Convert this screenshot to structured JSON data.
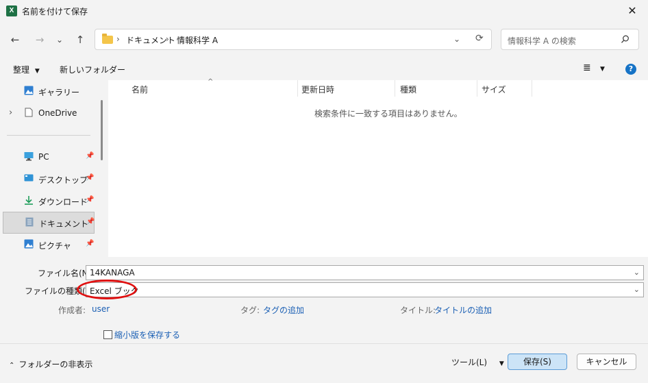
{
  "window": {
    "title": "名前を付けて保存",
    "app_icon_letter": "X",
    "close_glyph": "✕"
  },
  "nav": {
    "back": "←",
    "forward": "→",
    "recent": "⌄",
    "up": "↑",
    "breadcrumb": [
      "ドキュメント",
      "情報科学 A"
    ],
    "breadcrumb_sep": "›",
    "dropdown_glyph": "⌄",
    "refresh_glyph": "⟳",
    "search_placeholder": "情報科学 A の検索"
  },
  "toolbar": {
    "organize": "整理",
    "new_folder": "新しいフォルダー",
    "view_glyph": "≣",
    "help_glyph": "?"
  },
  "sidebar": {
    "items": [
      {
        "label": "ギャラリー",
        "icon": "gallery-icon"
      },
      {
        "label": "OneDrive",
        "icon": "onedrive-icon"
      },
      {
        "label": "PC",
        "icon": "pc-icon"
      },
      {
        "label": "デスクトップ",
        "icon": "desktop-icon"
      },
      {
        "label": "ダウンロード",
        "icon": "download-icon"
      },
      {
        "label": "ドキュメント",
        "icon": "documents-icon",
        "selected": true
      },
      {
        "label": "ピクチャ",
        "icon": "pictures-icon"
      }
    ],
    "expand_glyph": "›",
    "pin_glyph": "📌"
  },
  "file_list": {
    "columns": [
      "名前",
      "更新日時",
      "種類",
      "サイズ"
    ],
    "sort_glyph": "^",
    "empty_message": "検索条件に一致する項目はありません。"
  },
  "form": {
    "filename_label": "ファイル名(N):",
    "filename_value": "14KANAGA",
    "filetype_label": "ファイルの種類(T):",
    "filetype_value": "Excel ブック",
    "author_label": "作成者:",
    "author_value": "user",
    "tags_label": "タグ:",
    "tags_value": "タグの追加",
    "title_label": "タイトル:",
    "title_value": "タイトルの追加",
    "thumbnail_label": "縮小版を保存する",
    "thumbnail_checked": false
  },
  "footer": {
    "hide_folders": "フォルダーの非表示",
    "tools": "ツール(L)",
    "save": "保存(S)",
    "cancel": "キャンセル"
  },
  "colors": {
    "accent": "#1673c6",
    "link": "#1a5fb4",
    "highlight_ellipse": "#e01010",
    "excel_green": "#1e7145"
  }
}
